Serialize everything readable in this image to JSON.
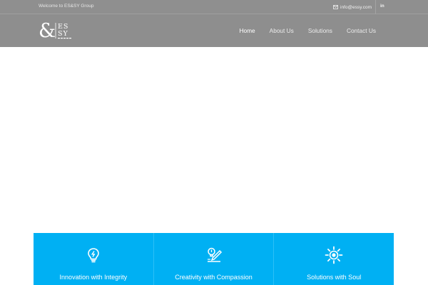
{
  "topbar": {
    "welcome": "Welcome to ES&SY Group",
    "email_icon": "envelope-icon",
    "email": "info@essy.com",
    "social_label": "in",
    "social_icon": "linkedin-icon"
  },
  "header": {
    "logo_letters": "ES SY",
    "nav": [
      {
        "label": "Home"
      },
      {
        "label": "About Us"
      },
      {
        "label": "Solutions"
      },
      {
        "label": "Contact Us"
      }
    ]
  },
  "features": [
    {
      "icon": "lightbulb-icon",
      "title": "Innovation with Integrity"
    },
    {
      "icon": "pencil-idea-icon",
      "title": "Creativity with Compassion"
    },
    {
      "icon": "sun-icon",
      "title": "Solutions with Soul"
    }
  ],
  "colors": {
    "accent": "#00b0f3",
    "header_bg": "#8e8e8e"
  }
}
